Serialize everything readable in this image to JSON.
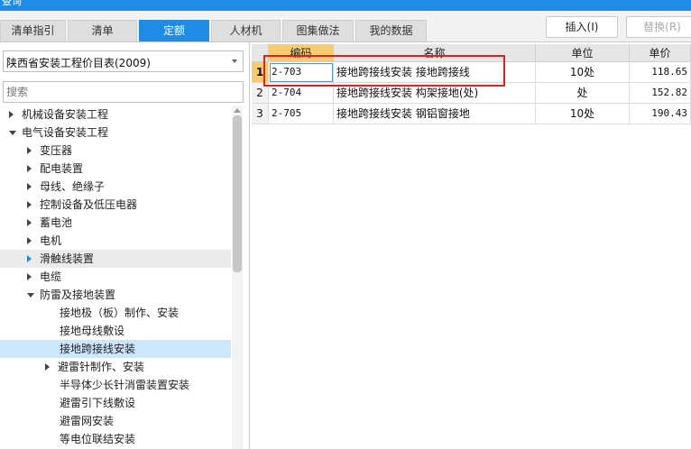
{
  "window": {
    "title": "查询"
  },
  "tabs": [
    {
      "label": "清单指引"
    },
    {
      "label": "清单"
    },
    {
      "label": "定额"
    },
    {
      "label": "人材机"
    },
    {
      "label": "图集做法"
    },
    {
      "label": "我的数据"
    }
  ],
  "active_tab": "定额",
  "toolbar": {
    "insert_label": "插入(I)",
    "replace_label": "替换(R)"
  },
  "left": {
    "catalog_select": "陕西省安装工程价目表(2009)",
    "search_placeholder": "搜索",
    "tree": [
      {
        "label": "机械设备安装工程",
        "level": 0,
        "state": "collapsed"
      },
      {
        "label": "电气设备安装工程",
        "level": 0,
        "state": "expanded"
      },
      {
        "label": "变压器",
        "level": 1,
        "state": "collapsed"
      },
      {
        "label": "配电装置",
        "level": 1,
        "state": "collapsed"
      },
      {
        "label": "母线、绝缘子",
        "level": 1,
        "state": "collapsed"
      },
      {
        "label": "控制设备及低压电器",
        "level": 1,
        "state": "collapsed"
      },
      {
        "label": "蓄电池",
        "level": 1,
        "state": "collapsed"
      },
      {
        "label": "电机",
        "level": 1,
        "state": "collapsed"
      },
      {
        "label": "滑触线装置",
        "level": 1,
        "state": "collapsed",
        "hover": true
      },
      {
        "label": "电缆",
        "level": 1,
        "state": "collapsed"
      },
      {
        "label": "防雷及接地装置",
        "level": 1,
        "state": "expanded"
      },
      {
        "label": "接地极（板）制作、安装",
        "level": 2,
        "state": "leaf"
      },
      {
        "label": "接地母线敷设",
        "level": 2,
        "state": "leaf"
      },
      {
        "label": "接地跨接线安装",
        "level": 2,
        "state": "leaf",
        "selected": true
      },
      {
        "label": "避雷针制作、安装",
        "level": 2,
        "state": "collapsed"
      },
      {
        "label": "半导体少长针消雷装置安装",
        "level": 2,
        "state": "leaf"
      },
      {
        "label": "避雷引下线敷设",
        "level": 2,
        "state": "leaf"
      },
      {
        "label": "避雷网安装",
        "level": 2,
        "state": "leaf"
      },
      {
        "label": "等电位联结安装",
        "level": 2,
        "state": "leaf"
      }
    ]
  },
  "table": {
    "headers": {
      "code": "编码",
      "name": "名称",
      "unit": "单位",
      "price": "单价"
    },
    "rows": [
      {
        "num": "1",
        "code": "2-703",
        "name": "接地跨接线安装 接地跨接线",
        "unit": "10处",
        "price": "118.65"
      },
      {
        "num": "2",
        "code": "2-704",
        "name": "接地跨接线安装 构架接地(处)",
        "unit": "处",
        "price": "152.82"
      },
      {
        "num": "3",
        "code": "2-705",
        "name": "接地跨接线安装 钢铝窗接地",
        "unit": "10处",
        "price": "190.43"
      }
    ],
    "current_row": 0
  },
  "colors": {
    "accent": "#1e8be6",
    "highlight": "#f6cc70",
    "annotation": "#e0201d",
    "selected_bg": "#cce6fa"
  }
}
